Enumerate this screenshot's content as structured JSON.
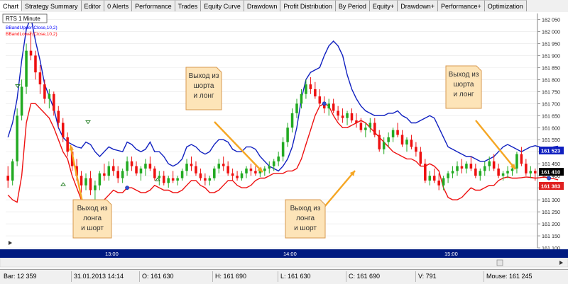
{
  "tabs": [
    "Chart",
    "Strategy Summary",
    "Editor",
    "0 Alerts",
    "Performance",
    "Trades",
    "Equity Curve",
    "Drawdown",
    "Profit Distribution",
    "By Period",
    "Equity+",
    "Drawdown+",
    "Performance+",
    "Optimization"
  ],
  "chart": {
    "instrument_label": "RTS 1 Minute",
    "legend": [
      {
        "label": "BBandUpper(Close,10,2)",
        "color": "#0000ff"
      },
      {
        "label": "BBandLower(Close,10,2)",
        "color": "#ff0000"
      }
    ],
    "y_ticks": [
      "162 050",
      "162 000",
      "161 950",
      "161 900",
      "161 850",
      "161 800",
      "161 750",
      "161 700",
      "161 650",
      "161 600",
      "161 550",
      "161 500",
      "161 450",
      "161 400",
      "161 350",
      "161 300",
      "161 250",
      "161 200",
      "161 150",
      "161 100"
    ],
    "x_ticks": [
      "13:00",
      "14:00",
      "15:00"
    ],
    "price_markers": [
      {
        "label": "161 523",
        "bg": "#1020c0",
        "fg": "#ffffff"
      },
      {
        "label": "161 410",
        "bg": "#000000",
        "fg": "#ffffff"
      },
      {
        "label": "161 383",
        "bg": "#e02020",
        "fg": "#ffffff"
      }
    ],
    "annotations": [
      {
        "text": "Выход из лонга и шорт"
      },
      {
        "text": "Выход из шорта и лонг"
      },
      {
        "text": "Выход из лонга и шорт"
      },
      {
        "text": "Выход из шорта и лонг"
      }
    ],
    "colors": {
      "up_candle": "#22aa22",
      "down_candle": "#ee1111",
      "upper_band": "#1020c0",
      "lower_band": "#ee1111",
      "time_axis": "#001a80",
      "callout_bg": "#fde4b8",
      "callout_border": "#d89a50",
      "arrow": "#f5a623"
    }
  },
  "chart_data": {
    "type": "candlestick",
    "title": "RTS 1 Minute",
    "ylim": [
      161100,
      162075
    ],
    "x": [
      "13:00",
      "14:00",
      "15:00"
    ],
    "series": [
      {
        "name": "BBandUpper(Close,10,2)",
        "values": [
          161560,
          161620,
          161720,
          161880,
          162010,
          162060,
          161960,
          161880,
          161780,
          161730,
          161680,
          161600,
          161560,
          161540,
          161530,
          161520,
          161515,
          161540,
          161530,
          161500,
          161480,
          161500,
          161520,
          161510,
          161505,
          161500,
          161540,
          161530,
          161510,
          161500,
          161510,
          161540,
          161500,
          161500,
          161480,
          161450,
          161440,
          161450,
          161470,
          161520,
          161530,
          161520,
          161500,
          161490,
          161500,
          161530,
          161550,
          161550,
          161540,
          161510,
          161500,
          161500,
          161520,
          161520,
          161510,
          161480,
          161460,
          161440,
          161430,
          161420,
          161440,
          161470,
          161520,
          161600,
          161720,
          161800,
          161830,
          161840,
          161850,
          161900,
          161940,
          161960,
          161940,
          161900,
          161820,
          161760,
          161720,
          161690,
          161670,
          161660,
          161650,
          161650,
          161650,
          161660,
          161660,
          161670,
          161650,
          161640,
          161620,
          161620,
          161630,
          161640,
          161650,
          161640,
          161600,
          161560,
          161520,
          161510,
          161500,
          161490,
          161480,
          161480,
          161470,
          161460,
          161460,
          161470,
          161480,
          161500,
          161520,
          161530,
          161520,
          161510,
          161500,
          161510,
          161520,
          161525,
          161520,
          161515,
          161515,
          161520,
          161523
        ]
      },
      {
        "name": "BBandLower(Close,10,2)",
        "values": [
          161320,
          161300,
          161290,
          161400,
          161620,
          161700,
          161700,
          161680,
          161660,
          161640,
          161600,
          161550,
          161500,
          161470,
          161400,
          161350,
          161300,
          161290,
          161270,
          161260,
          161270,
          161300,
          161320,
          161340,
          161330,
          161330,
          161350,
          161350,
          161340,
          161330,
          161330,
          161340,
          161360,
          161350,
          161340,
          161340,
          161330,
          161330,
          161340,
          161360,
          161380,
          161380,
          161360,
          161350,
          161330,
          161330,
          161340,
          161360,
          161380,
          161380,
          161360,
          161350,
          161350,
          161360,
          161380,
          161390,
          161390,
          161400,
          161410,
          161410,
          161410,
          161420,
          161420,
          161430,
          161470,
          161530,
          161590,
          161650,
          161690,
          161700,
          161690,
          161650,
          161620,
          161600,
          161600,
          161610,
          161620,
          161630,
          161620,
          161600,
          161580,
          161560,
          161540,
          161520,
          161500,
          161490,
          161480,
          161470,
          161470,
          161460,
          161440,
          161440,
          161450,
          161440,
          161420,
          161350,
          161310,
          161300,
          161300,
          161310,
          161330,
          161350,
          161340,
          161340,
          161350,
          161360,
          161360,
          161380,
          161390,
          161395,
          161390,
          161390,
          161392,
          161395,
          161393,
          161390,
          161392,
          161395,
          161390,
          161388,
          161383
        ]
      }
    ],
    "ohlc": [
      [
        161400,
        161440,
        161350,
        161380
      ],
      [
        161380,
        161470,
        161360,
        161460
      ],
      [
        161460,
        161680,
        161440,
        161650
      ],
      [
        161650,
        161800,
        161630,
        161770
      ],
      [
        161770,
        161950,
        161740,
        161920
      ],
      [
        161920,
        162000,
        161880,
        161900
      ],
      [
        161900,
        161920,
        161800,
        161830
      ],
      [
        161830,
        161860,
        161740,
        161780
      ],
      [
        161780,
        161800,
        161700,
        161720
      ],
      [
        161720,
        161760,
        161680,
        161740
      ],
      [
        161740,
        161750,
        161650,
        161670
      ],
      [
        161670,
        161690,
        161600,
        161620
      ],
      [
        161620,
        161640,
        161540,
        161560
      ],
      [
        161560,
        161580,
        161480,
        161500
      ],
      [
        161500,
        161520,
        161420,
        161440
      ],
      [
        161440,
        161470,
        161380,
        161400
      ],
      [
        161400,
        161420,
        161330,
        161360
      ],
      [
        161360,
        161410,
        161340,
        161390
      ],
      [
        161390,
        161420,
        161320,
        161340
      ],
      [
        161340,
        161380,
        161300,
        161360
      ],
      [
        161360,
        161420,
        161340,
        161410
      ],
      [
        161410,
        161450,
        161380,
        161400
      ],
      [
        161400,
        161460,
        161380,
        161440
      ],
      [
        161440,
        161470,
        161400,
        161420
      ],
      [
        161420,
        161440,
        161370,
        161390
      ],
      [
        161390,
        161430,
        161370,
        161420
      ],
      [
        161420,
        161480,
        161400,
        161460
      ],
      [
        161460,
        161480,
        161420,
        161440
      ],
      [
        161440,
        161460,
        161400,
        161410
      ],
      [
        161410,
        161440,
        161380,
        161430
      ],
      [
        161430,
        161470,
        161400,
        161450
      ],
      [
        161450,
        161480,
        161420,
        161430
      ],
      [
        161430,
        161440,
        161380,
        161390
      ],
      [
        161390,
        161420,
        161360,
        161400
      ],
      [
        161400,
        161420,
        161360,
        161370
      ],
      [
        161370,
        161400,
        161350,
        161390
      ],
      [
        161390,
        161420,
        161370,
        161380
      ],
      [
        161380,
        161400,
        161360,
        161390
      ],
      [
        161390,
        161430,
        161380,
        161420
      ],
      [
        161420,
        161470,
        161400,
        161450
      ],
      [
        161450,
        161480,
        161420,
        161440
      ],
      [
        161440,
        161460,
        161400,
        161410
      ],
      [
        161410,
        161430,
        161380,
        161390
      ],
      [
        161390,
        161410,
        161360,
        161380
      ],
      [
        161380,
        161400,
        161360,
        161390
      ],
      [
        161390,
        161440,
        161380,
        161430
      ],
      [
        161430,
        161470,
        161410,
        161450
      ],
      [
        161450,
        161480,
        161420,
        161440
      ],
      [
        161440,
        161460,
        161400,
        161410
      ],
      [
        161410,
        161430,
        161380,
        161400
      ],
      [
        161400,
        161420,
        161380,
        161390
      ],
      [
        161390,
        161420,
        161380,
        161410
      ],
      [
        161410,
        161440,
        161390,
        161430
      ],
      [
        161430,
        161450,
        161400,
        161420
      ],
      [
        161420,
        161440,
        161400,
        161410
      ],
      [
        161410,
        161430,
        161395,
        161420
      ],
      [
        161420,
        161440,
        161400,
        161430
      ],
      [
        161430,
        161460,
        161410,
        161440
      ],
      [
        161440,
        161470,
        161420,
        161460
      ],
      [
        161460,
        161500,
        161440,
        161480
      ],
      [
        161480,
        161560,
        161460,
        161540
      ],
      [
        161540,
        161620,
        161520,
        161600
      ],
      [
        161600,
        161680,
        161580,
        161660
      ],
      [
        161660,
        161720,
        161640,
        161700
      ],
      [
        161700,
        161760,
        161680,
        161740
      ],
      [
        161740,
        161800,
        161720,
        161780
      ],
      [
        161780,
        161810,
        161740,
        161760
      ],
      [
        161760,
        161790,
        161720,
        161730
      ],
      [
        161730,
        161760,
        161690,
        161700
      ],
      [
        161700,
        161730,
        161660,
        161680
      ],
      [
        161680,
        161720,
        161650,
        161700
      ],
      [
        161700,
        161720,
        161660,
        161670
      ],
      [
        161670,
        161690,
        161630,
        161650
      ],
      [
        161650,
        161680,
        161620,
        161640
      ],
      [
        161640,
        161670,
        161610,
        161660
      ],
      [
        161660,
        161680,
        161620,
        161630
      ],
      [
        161630,
        161660,
        161600,
        161620
      ],
      [
        161620,
        161640,
        161580,
        161590
      ],
      [
        161590,
        161620,
        161560,
        161600
      ],
      [
        161600,
        161640,
        161580,
        161620
      ],
      [
        161620,
        161640,
        161560,
        161570
      ],
      [
        161570,
        161590,
        161500,
        161510
      ],
      [
        161510,
        161560,
        161490,
        161540
      ],
      [
        161540,
        161580,
        161520,
        161560
      ],
      [
        161560,
        161600,
        161540,
        161590
      ],
      [
        161590,
        161620,
        161560,
        161570
      ],
      [
        161570,
        161590,
        161520,
        161530
      ],
      [
        161530,
        161560,
        161500,
        161550
      ],
      [
        161550,
        161570,
        161510,
        161520
      ],
      [
        161520,
        161540,
        161480,
        161500
      ],
      [
        161500,
        161520,
        161440,
        161450
      ],
      [
        161450,
        161470,
        161370,
        161380
      ],
      [
        161380,
        161420,
        161360,
        161400
      ],
      [
        161400,
        161430,
        161370,
        161380
      ],
      [
        161380,
        161410,
        161340,
        161360
      ],
      [
        161360,
        161400,
        161340,
        161390
      ],
      [
        161390,
        161420,
        161370,
        161410
      ],
      [
        161410,
        161440,
        161390,
        161420
      ],
      [
        161420,
        161460,
        161400,
        161440
      ],
      [
        161440,
        161470,
        161410,
        161430
      ],
      [
        161430,
        161460,
        161410,
        161450
      ],
      [
        161450,
        161480,
        161420,
        161430
      ],
      [
        161430,
        161450,
        161390,
        161400
      ],
      [
        161400,
        161430,
        161380,
        161420
      ],
      [
        161420,
        161460,
        161400,
        161440
      ],
      [
        161440,
        161480,
        161420,
        161460
      ],
      [
        161460,
        161490,
        161420,
        161430
      ],
      [
        161430,
        161450,
        161390,
        161400
      ],
      [
        161400,
        161420,
        161380,
        161410
      ],
      [
        161410,
        161440,
        161390,
        161420
      ],
      [
        161420,
        161450,
        161400,
        161430
      ],
      [
        161430,
        161500,
        161410,
        161490
      ],
      [
        161490,
        161520,
        161440,
        161450
      ],
      [
        161450,
        161470,
        161400,
        161410
      ],
      [
        161410,
        161440,
        161390,
        161420
      ],
      [
        161420,
        161430,
        161380,
        161410
      ]
    ]
  },
  "status_bar": [
    {
      "label": "Bar: 12 359"
    },
    {
      "label": "31.01.2013 14:14"
    },
    {
      "label": "O: 161 630"
    },
    {
      "label": "H: 161 690"
    },
    {
      "label": "L: 161 630"
    },
    {
      "label": "C: 161 690"
    },
    {
      "label": "V: 791"
    },
    {
      "label": "Mouse: 161 245"
    }
  ]
}
